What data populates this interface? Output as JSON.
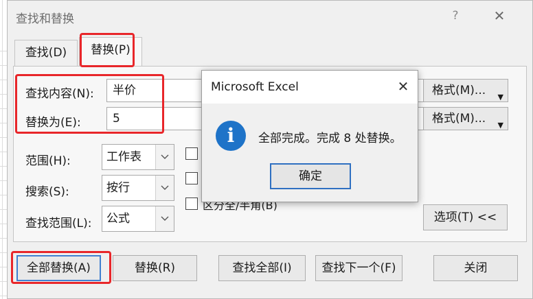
{
  "window": {
    "title": "查找和替换",
    "help": "?",
    "close": "✕"
  },
  "tabs": [
    {
      "label": "查找(D)"
    },
    {
      "label": "替换(P)"
    }
  ],
  "find": {
    "label": "查找内容(N):",
    "value": "半价"
  },
  "replace": {
    "label": "替换为(E):",
    "value": "5"
  },
  "format_button": "格式(M)...",
  "options": {
    "within": {
      "label": "范围(H):",
      "value": "工作表"
    },
    "search": {
      "label": "搜索(S):",
      "value": "按行"
    },
    "look_in": {
      "label": "查找范围(L):",
      "value": "公式"
    },
    "checkbox_partial": "区分全/半角(B)",
    "options_button": "选项(T) <<"
  },
  "buttons": {
    "replace_all": "全部替换(A)",
    "replace": "替换(R)",
    "find_all": "查找全部(I)",
    "find_next": "查找下一个(F)",
    "close": "关闭"
  },
  "messagebox": {
    "title": "Microsoft Excel",
    "close": "✕",
    "icon": "i",
    "message": "全部完成。完成 8 处替换。",
    "ok": "确定"
  },
  "colors": {
    "highlight": "#e8262a",
    "accent": "#1e73c8"
  }
}
